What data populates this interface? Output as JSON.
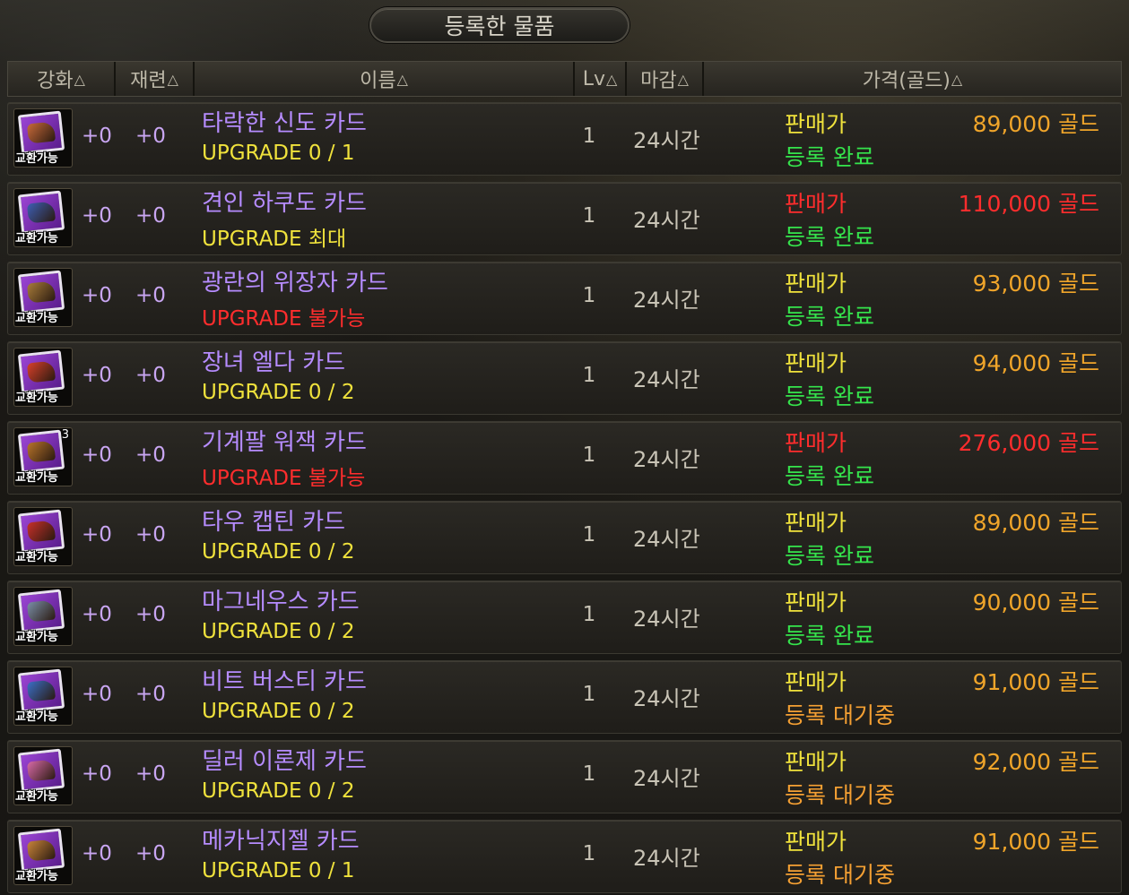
{
  "window": {
    "title": "등록한 물품"
  },
  "columns": [
    {
      "key": "enhance",
      "label": "강화",
      "arrow": "△"
    },
    {
      "key": "refine",
      "label": "재련",
      "arrow": "△"
    },
    {
      "key": "name",
      "label": "이름",
      "arrow": "△"
    },
    {
      "key": "level",
      "label": "Lv",
      "arrow": "△"
    },
    {
      "key": "deadline",
      "label": "마감",
      "arrow": "△"
    },
    {
      "key": "price",
      "label": "가격(골드)",
      "arrow": "△"
    }
  ],
  "items": [
    {
      "badge": "교환가능",
      "stack": "",
      "icon": "card-icon-fallen-believer",
      "enhance": "+0",
      "refine": "+0",
      "name": "타락한 신도 카드",
      "upgrade": "UPGRADE 0 / 1",
      "upgrade_color": "yellow",
      "level": "1",
      "deadline": "24시간",
      "price_label": "판매가",
      "price": "89,000 골드",
      "price_color": "normal",
      "status": "등록 완료",
      "status_color": "green"
    },
    {
      "badge": "교환가능",
      "stack": "",
      "icon": "card-icon-hakudo",
      "enhance": "+0",
      "refine": "+0",
      "name": "견인 하쿠도 카드",
      "upgrade": "UPGRADE 최대",
      "upgrade_color": "yellow",
      "level": "1",
      "deadline": "24시간",
      "price_label": "판매가",
      "price": "110,000 골드",
      "price_color": "red",
      "status": "등록 완료",
      "status_color": "green"
    },
    {
      "badge": "교환가능",
      "stack": "",
      "icon": "card-icon-frenzied-disguiser",
      "enhance": "+0",
      "refine": "+0",
      "name": "광란의 위장자 카드",
      "upgrade": "UPGRADE 불가능",
      "upgrade_color": "red",
      "level": "1",
      "deadline": "24시간",
      "price_label": "판매가",
      "price": "93,000 골드",
      "price_color": "normal",
      "status": "등록 완료",
      "status_color": "green"
    },
    {
      "badge": "교환가능",
      "stack": "",
      "icon": "card-icon-elda",
      "enhance": "+0",
      "refine": "+0",
      "name": "장녀 엘다 카드",
      "upgrade": "UPGRADE 0 / 2",
      "upgrade_color": "yellow",
      "level": "1",
      "deadline": "24시간",
      "price_label": "판매가",
      "price": "94,000 골드",
      "price_color": "normal",
      "status": "등록 완료",
      "status_color": "green"
    },
    {
      "badge": "교환가능",
      "stack": "3",
      "icon": "card-icon-wojack",
      "enhance": "+0",
      "refine": "+0",
      "name": "기계팔 워잭 카드",
      "upgrade": "UPGRADE 불가능",
      "upgrade_color": "red",
      "level": "1",
      "deadline": "24시간",
      "price_label": "판매가",
      "price": "276,000 골드",
      "price_color": "red",
      "status": "등록 완료",
      "status_color": "green"
    },
    {
      "badge": "교환가능",
      "stack": "",
      "icon": "card-icon-tau-captain",
      "enhance": "+0",
      "refine": "+0",
      "name": "타우 캡틴 카드",
      "upgrade": "UPGRADE 0 / 2",
      "upgrade_color": "yellow",
      "level": "1",
      "deadline": "24시간",
      "price_label": "판매가",
      "price": "89,000 골드",
      "price_color": "normal",
      "status": "등록 완료",
      "status_color": "green"
    },
    {
      "badge": "교환가능",
      "stack": "",
      "icon": "card-icon-magnus",
      "enhance": "+0",
      "refine": "+0",
      "name": "마그네우스 카드",
      "upgrade": "UPGRADE 0 / 2",
      "upgrade_color": "yellow",
      "level": "1",
      "deadline": "24시간",
      "price_label": "판매가",
      "price": "90,000 골드",
      "price_color": "normal",
      "status": "등록 완료",
      "status_color": "green"
    },
    {
      "badge": "교환가능",
      "stack": "",
      "icon": "card-icon-beat-bustee",
      "enhance": "+0",
      "refine": "+0",
      "name": "비트 버스티 카드",
      "upgrade": "UPGRADE 0 / 2",
      "upgrade_color": "yellow",
      "level": "1",
      "deadline": "24시간",
      "price_label": "판매가",
      "price": "91,000 골드",
      "price_color": "normal",
      "status": "등록 대기중",
      "status_color": "orange"
    },
    {
      "badge": "교환가능",
      "stack": "",
      "icon": "card-icon-dealer-ironje",
      "enhance": "+0",
      "refine": "+0",
      "name": "딜러 이론제 카드",
      "upgrade": "UPGRADE 0 / 2",
      "upgrade_color": "yellow",
      "level": "1",
      "deadline": "24시간",
      "price_label": "판매가",
      "price": "92,000 골드",
      "price_color": "normal",
      "status": "등록 대기중",
      "status_color": "orange"
    },
    {
      "badge": "교환가능",
      "stack": "",
      "icon": "card-icon-mechanic-zizel",
      "enhance": "+0",
      "refine": "+0",
      "name": "메카닉지젤 카드",
      "upgrade": "UPGRADE 0 / 1",
      "upgrade_color": "yellow",
      "level": "1",
      "deadline": "24시간",
      "price_label": "판매가",
      "price": "91,000 골드",
      "price_color": "normal",
      "status": "등록 대기중",
      "status_color": "orange"
    }
  ],
  "colors": {
    "name": "#b68cff",
    "upgrade_yellow": "#f0e23c",
    "red": "#ff2d2d",
    "price_normal": "#f0a52a",
    "status_green": "#35e44c",
    "status_orange": "#f5a033"
  }
}
